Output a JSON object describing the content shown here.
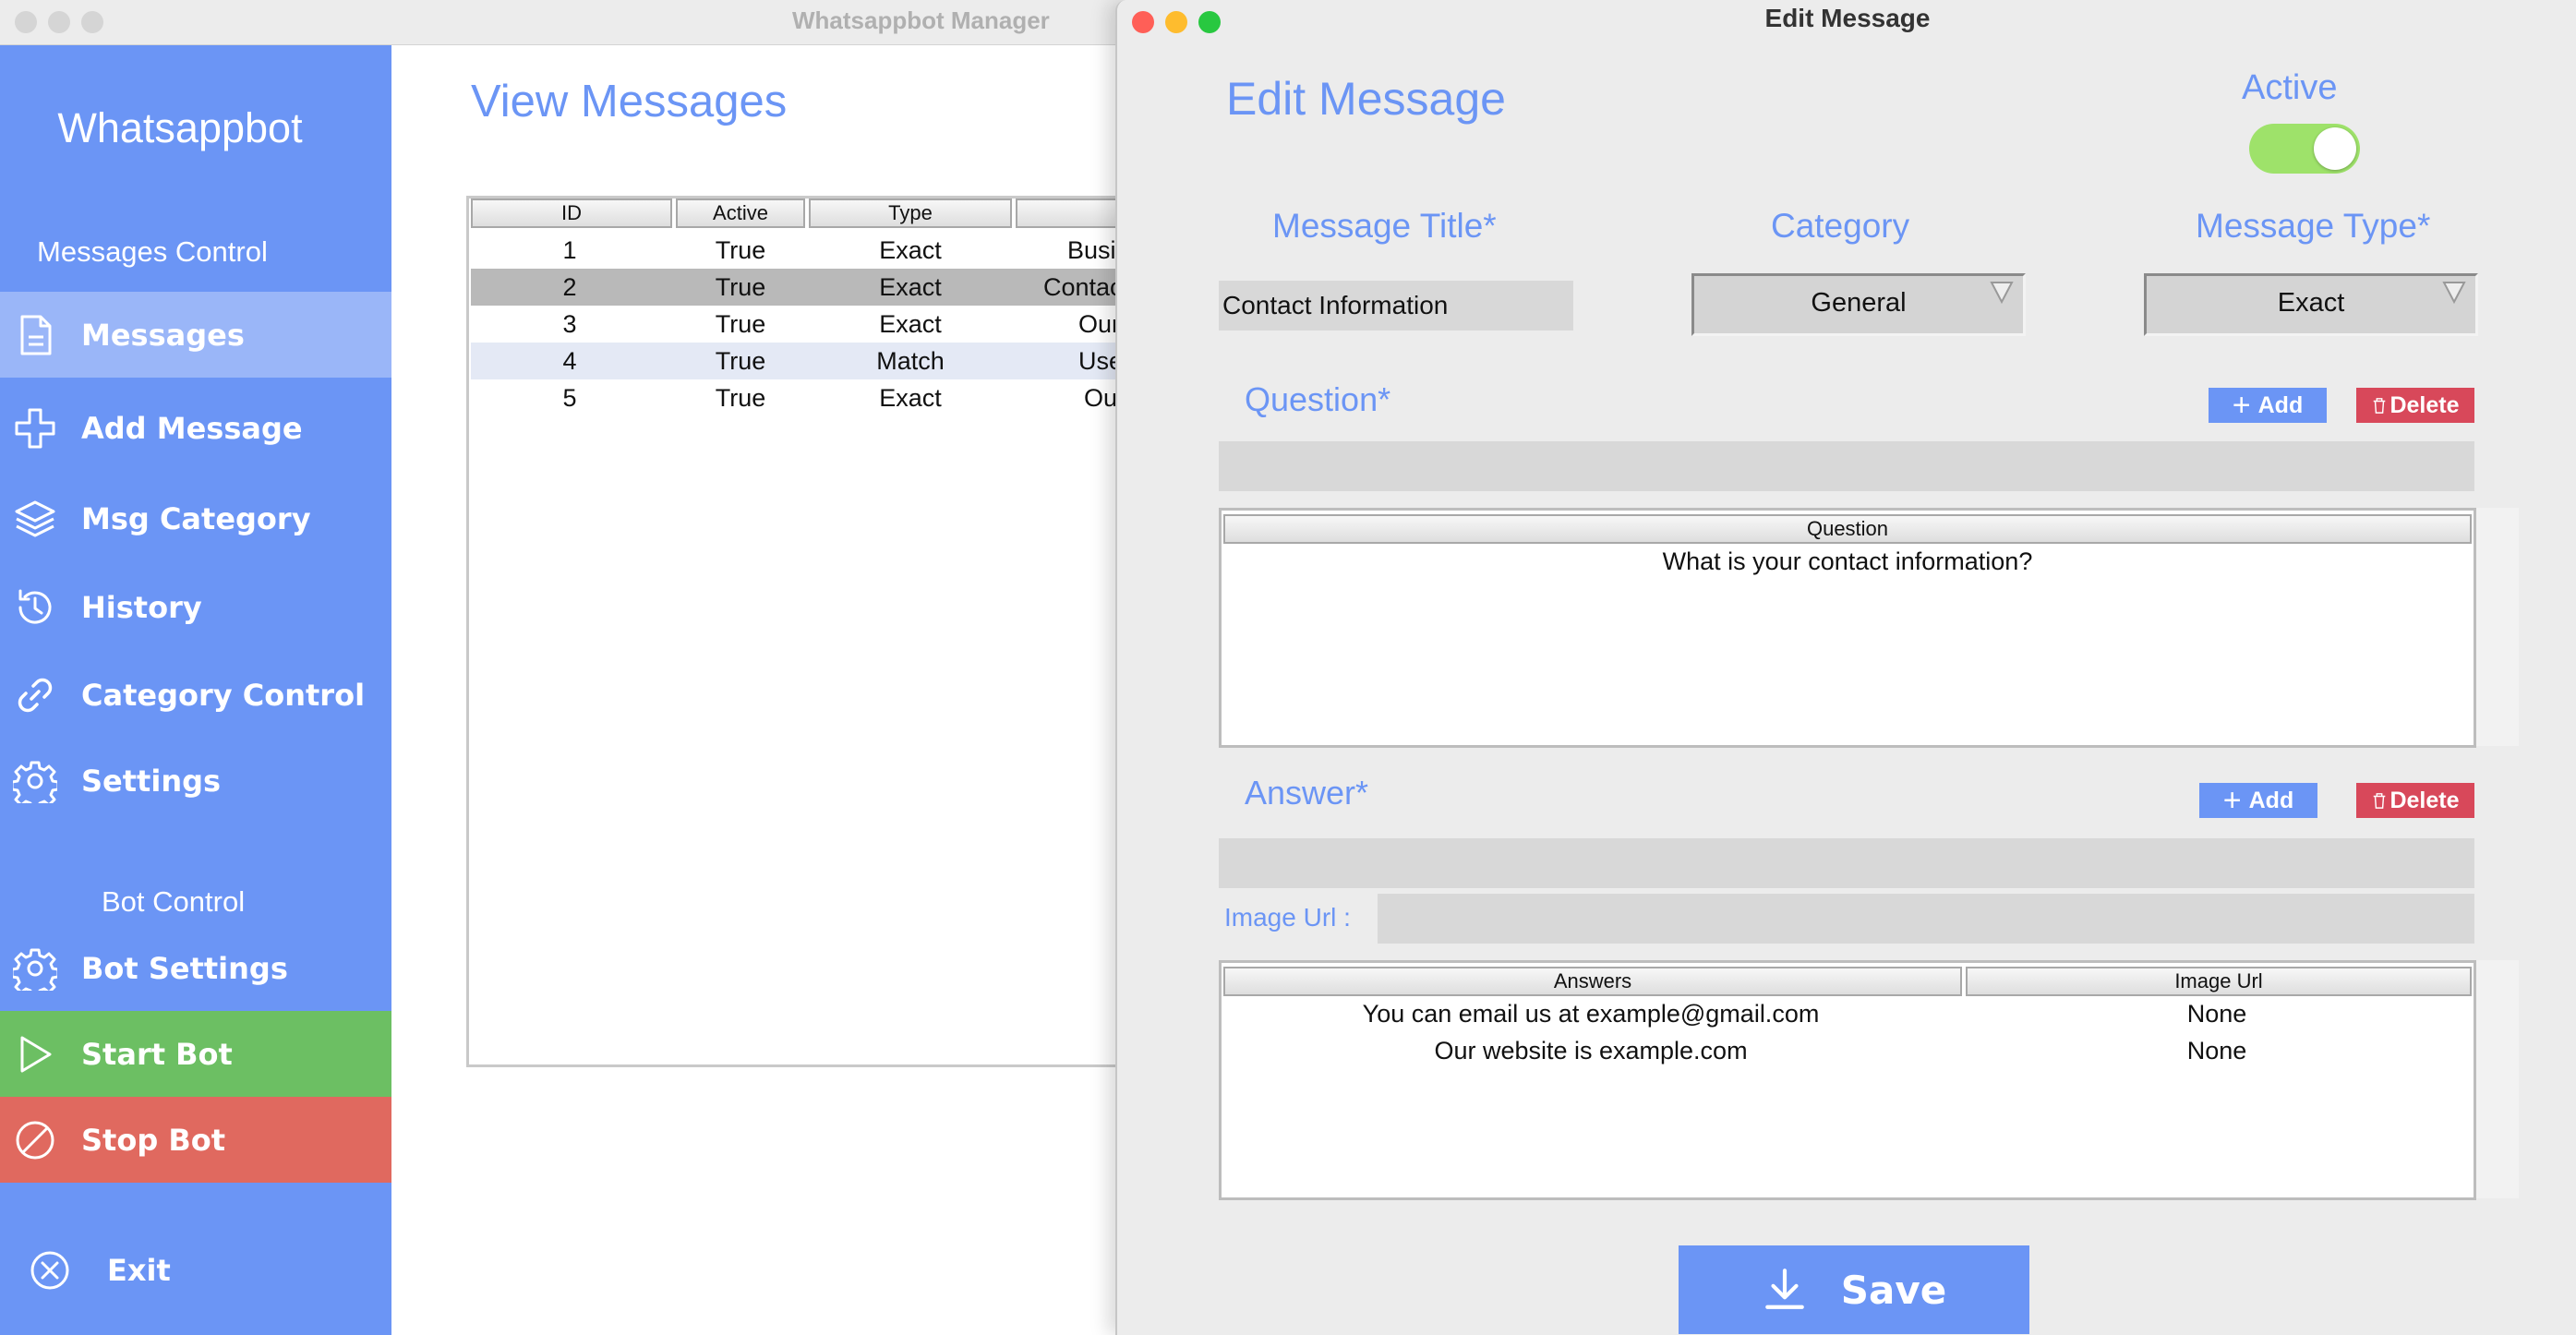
{
  "main_window": {
    "title": "Whatsappbot Manager",
    "traffic_lights": [
      "close",
      "minimize",
      "zoom"
    ]
  },
  "sidebar": {
    "brand": "Whatsappbot",
    "messages_section": "Messages Control",
    "items": [
      {
        "label": "Messages",
        "icon": "document-icon"
      },
      {
        "label": "Add Message",
        "icon": "plus-icon"
      },
      {
        "label": "Msg Category",
        "icon": "layers-icon"
      },
      {
        "label": "History",
        "icon": "history-icon"
      },
      {
        "label": "Category Control",
        "icon": "link-icon"
      },
      {
        "label": "Settings",
        "icon": "gear-icon"
      }
    ],
    "bot_section": "Bot Control",
    "bot_items": [
      {
        "label": "Bot Settings",
        "icon": "gear-icon"
      },
      {
        "label": "Start Bot",
        "icon": "play-icon"
      },
      {
        "label": "Stop Bot",
        "icon": "stop-icon"
      }
    ],
    "exit_label": "Exit",
    "colors": {
      "sidebar": "#6b95f5",
      "active": "#9ab6f8",
      "start": "#6cbf63",
      "stop": "#e0695f"
    }
  },
  "view": {
    "title": "View Messages",
    "columns": [
      "ID",
      "Active",
      "Type",
      ""
    ],
    "rows": [
      {
        "id": "1",
        "active": "True",
        "type": "Exact",
        "title": "Busir"
      },
      {
        "id": "2",
        "active": "True",
        "type": "Exact",
        "title": "Contac"
      },
      {
        "id": "3",
        "active": "True",
        "type": "Exact",
        "title": "Our"
      },
      {
        "id": "4",
        "active": "True",
        "type": "Match",
        "title": "Use"
      },
      {
        "id": "5",
        "active": "True",
        "type": "Exact",
        "title": "Ou"
      }
    ]
  },
  "edit": {
    "window_title": "Edit Message",
    "heading": "Edit Message",
    "active_label": "Active",
    "active_on": true,
    "message_title_label": "Message Title*",
    "message_title_value": "Contact Information",
    "category_label": "Category",
    "category_value": "General",
    "message_type_label": "Message Type*",
    "message_type_value": "Exact",
    "question_label": "Question*",
    "add_label": "Add",
    "delete_label": "Delete",
    "question_input": "",
    "question_header": "Question",
    "questions": [
      "What is your contact information?"
    ],
    "answer_label": "Answer*",
    "answer_input": "",
    "image_url_label": "Image Url :",
    "image_url_input": "",
    "answers_header": "Answers",
    "image_url_header": "Image Url",
    "answers": [
      {
        "answer": "You can email us at example@gmail.com",
        "image_url": "None"
      },
      {
        "answer": "Our website is example.com",
        "image_url": "None"
      }
    ],
    "save_label": "Save"
  }
}
